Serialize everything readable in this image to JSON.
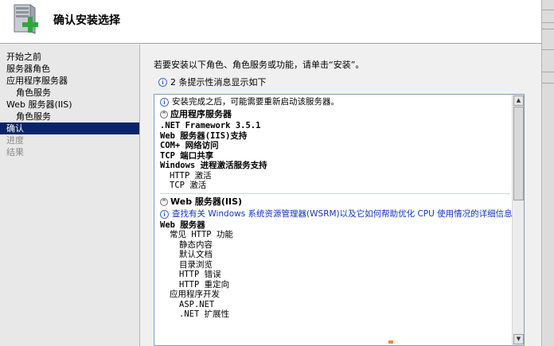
{
  "header": {
    "title": "确认安装选择",
    "icon": "server-add-icon"
  },
  "nav": {
    "items": [
      {
        "label": "开始之前",
        "level": 0,
        "state": "normal"
      },
      {
        "label": "服务器角色",
        "level": 0,
        "state": "normal"
      },
      {
        "label": "应用程序服务器",
        "level": 0,
        "state": "normal"
      },
      {
        "label": "角色服务",
        "level": 1,
        "state": "normal"
      },
      {
        "label": "Web 服务器(IIS)",
        "level": 0,
        "state": "normal"
      },
      {
        "label": "角色服务",
        "level": 1,
        "state": "normal"
      },
      {
        "label": "确认",
        "level": 0,
        "state": "active"
      },
      {
        "label": "进度",
        "level": 0,
        "state": "disabled"
      },
      {
        "label": "结果",
        "level": 0,
        "state": "disabled"
      }
    ]
  },
  "content": {
    "instruction": "若要安装以下角色、角色服务或功能，请单击“安装”。",
    "hint": "2 条提示性消息显示如下",
    "panel": {
      "notice": "安装完成之后，可能需要重新启动该服务器。",
      "sections": [
        {
          "title": "应用程序服务器",
          "items": [
            {
              "text": ".NET Framework 3.5.1",
              "indent": 1,
              "bold": true
            },
            {
              "text": "Web 服务器(IIS)支持",
              "indent": 1,
              "bold": true
            },
            {
              "text": "COM+ 网络访问",
              "indent": 1,
              "bold": true
            },
            {
              "text": "TCP 端口共享",
              "indent": 1,
              "bold": true
            },
            {
              "text": "Windows 进程激活服务支持",
              "indent": 1,
              "bold": true
            },
            {
              "text": "HTTP 激活",
              "indent": 2,
              "bold": false
            },
            {
              "text": "TCP 激活",
              "indent": 2,
              "bold": false
            }
          ]
        },
        {
          "title": "Web 服务器(IIS)",
          "link": "查找有关 Windows 系统资源管理器(WSRM)以及它如何帮助优化 CPU 使用情况的详细信息",
          "items": [
            {
              "text": "Web 服务器",
              "indent": 1,
              "bold": true
            },
            {
              "text": "常见 HTTP 功能",
              "indent": 2,
              "bold": false
            },
            {
              "text": "静态内容",
              "indent": 3,
              "bold": false
            },
            {
              "text": "默认文档",
              "indent": 3,
              "bold": false
            },
            {
              "text": "目录浏览",
              "indent": 3,
              "bold": false
            },
            {
              "text": "HTTP 错误",
              "indent": 3,
              "bold": false
            },
            {
              "text": "HTTP 重定向",
              "indent": 3,
              "bold": false
            },
            {
              "text": "应用程序开发",
              "indent": 2,
              "bold": false
            },
            {
              "text": "ASP.NET",
              "indent": 3,
              "bold": false
            },
            {
              "text": ".NET 扩展性",
              "indent": 3,
              "bold": false
            }
          ]
        }
      ]
    }
  },
  "colors": {
    "nav_active_bg": "#0a246a",
    "link": "#1234c8",
    "panel_border": "#7f9db9"
  }
}
